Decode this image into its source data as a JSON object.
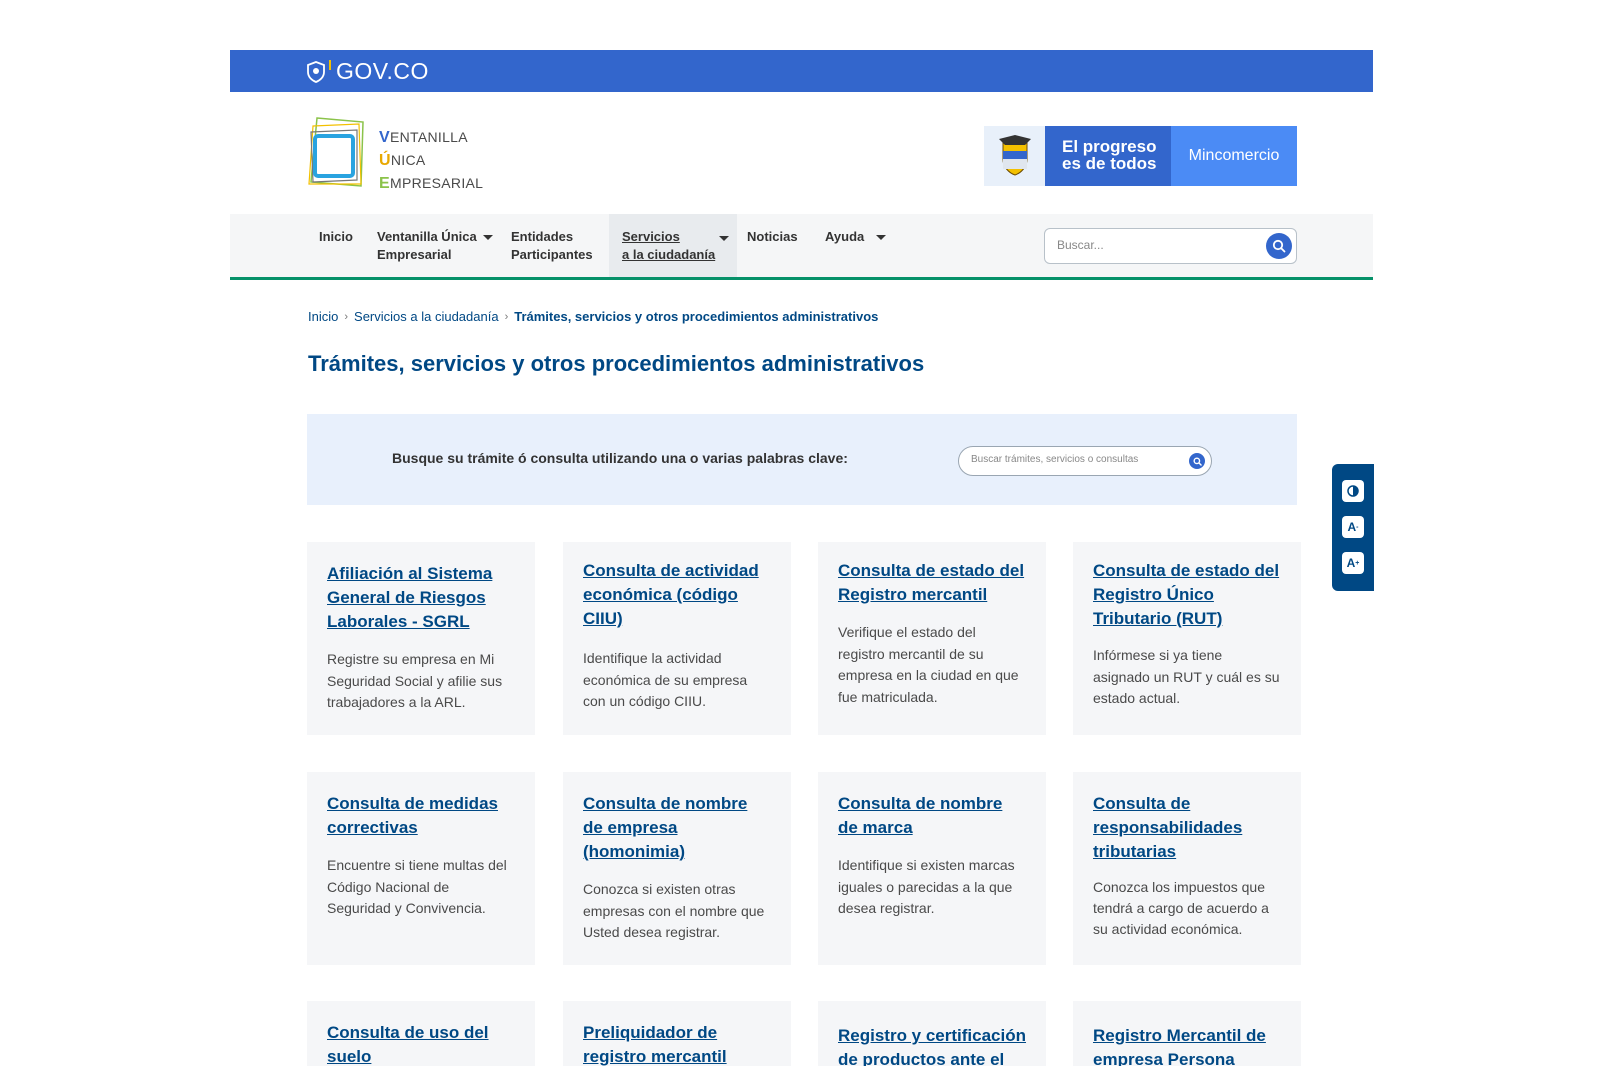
{
  "govbar": {
    "logo_text": "GOV.CO"
  },
  "header": {
    "brand_line1_cap": "V",
    "brand_line1_rest": "ENTANILLA",
    "brand_line2_cap": "Ú",
    "brand_line2_rest": "NICA",
    "brand_line3_cap": "E",
    "brand_line3_rest": "MPRESARIAL",
    "progreso_line1": "El progreso",
    "progreso_line2": "es de todos",
    "ministry": "Mincomercio"
  },
  "nav": {
    "items": [
      {
        "line1": "Inicio",
        "line2": ""
      },
      {
        "line1": "Ventanilla Única",
        "line2": "Empresarial"
      },
      {
        "line1": "Entidades",
        "line2": "Participantes"
      },
      {
        "line1": "Servicios",
        "line2": "a la ciudadanía"
      },
      {
        "line1": "Noticias",
        "line2": ""
      },
      {
        "line1": "Ayuda",
        "line2": ""
      }
    ],
    "search_placeholder": "Buscar..."
  },
  "breadcrumb": {
    "items": [
      "Inicio",
      "Servicios a la ciudadanía",
      "Trámites, servicios y otros procedimientos administrativos"
    ]
  },
  "page_title": "Trámites, servicios y otros procedimientos administrativos",
  "search_panel": {
    "label": "Busque su trámite ó consulta utilizando una o varias palabras clave:",
    "placeholder": "Buscar trámites, servicios o consultas"
  },
  "cards": [
    {
      "title": "Afiliación al Sistema General de Riesgos Laborales - SGRL",
      "desc": "Registre su empresa en Mi Seguridad Social y afilie sus trabajadores a la ARL."
    },
    {
      "title": "Consulta de actividad económica (código CIIU)",
      "desc": "Identifique la actividad económica de su empresa con un código CIIU."
    },
    {
      "title": "Consulta de estado del Registro mercantil",
      "desc": "Verifique el estado del registro mercantil de su empresa en la ciudad en que fue matriculada."
    },
    {
      "title": "Consulta de estado del Registro Único Tributario (RUT)",
      "desc": "Infórmese si ya tiene asignado un RUT y cuál es su estado actual."
    },
    {
      "title": "Consulta de medidas correctivas",
      "desc": "Encuentre si tiene multas del Código Nacional de Seguridad y Convivencia."
    },
    {
      "title": "Consulta de nombre de empresa (homonimia)",
      "desc": "Conozca si existen otras empresas con el nombre que Usted desea registrar."
    },
    {
      "title": "Consulta de nombre de marca",
      "desc": "Identifique si existen marcas iguales o parecidas a la que desea registrar."
    },
    {
      "title": "Consulta de responsabilidades tributarias",
      "desc": "Conozca los impuestos que tendrá a cargo de acuerdo a su actividad económica."
    },
    {
      "title": "Consulta de uso del suelo",
      "desc": ""
    },
    {
      "title": "Preliquidador de registro mercantil",
      "desc": ""
    },
    {
      "title": "Registro y certificación de productos ante el",
      "desc": ""
    },
    {
      "title": "Registro Mercantil de empresa Persona",
      "desc": ""
    }
  ],
  "a11y": {
    "contrast_icon": "contrast-icon",
    "font_smaller": "A",
    "font_larger": "A"
  }
}
